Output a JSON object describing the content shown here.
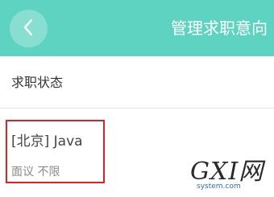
{
  "header": {
    "title": "管理求职意向",
    "background": "#5ed3c1"
  },
  "status": {
    "label": "求职状态"
  },
  "intent": {
    "title": "[北京] Java",
    "meta": "面议 不限",
    "highlight_color": "#d8232a"
  },
  "watermark": {
    "text": "GXI网",
    "subtext": "system.com"
  }
}
